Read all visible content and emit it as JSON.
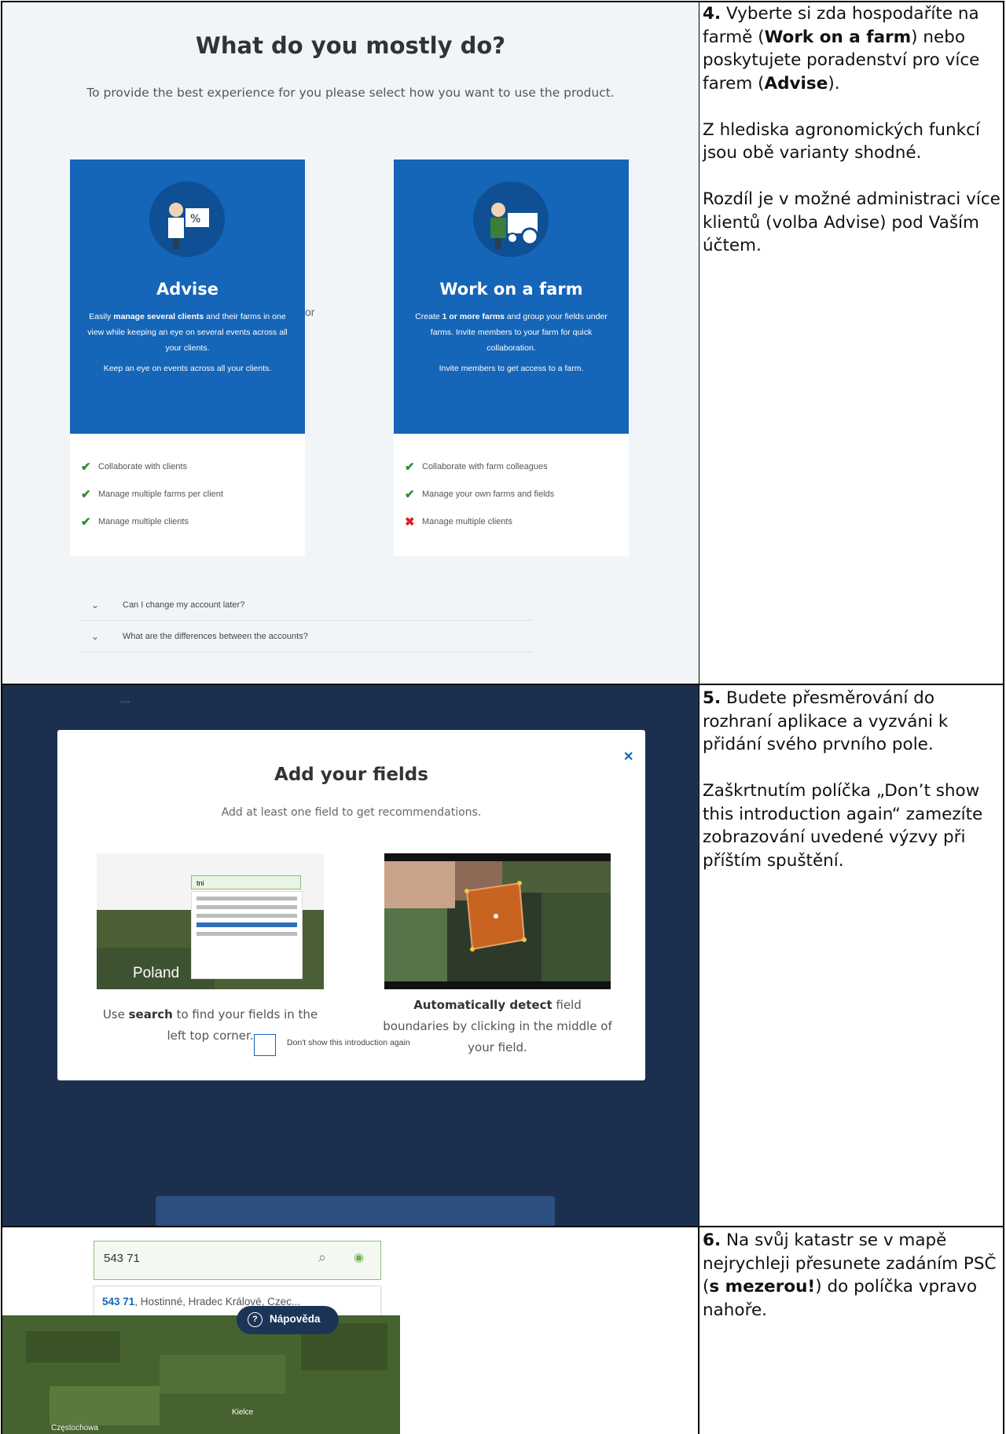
{
  "step4": {
    "heading": "What do you mostly do?",
    "subtitle": "To provide the best experience for you please select how you want to use the product.",
    "advise": {
      "title": "Advise",
      "desc_pre": "Easily ",
      "desc_bold": "manage several clients",
      "desc_post": " and their farms in one view while keeping an eye on several events across all your clients.",
      "desc2": "Keep an eye on events across all your clients.",
      "features": [
        "Collaborate with clients",
        "Manage multiple farms per client",
        "Manage multiple clients"
      ]
    },
    "or_label": "or",
    "farm": {
      "title": "Work on a farm",
      "desc_pre": "Create ",
      "desc_bold": "1 or more farms",
      "desc_post": " and group your fields under farms. Invite members to your farm for quick collaboration.",
      "desc2": "Invite members to get access to a farm.",
      "features": [
        "Collaborate with farm colleagues",
        "Manage your own farms and fields",
        "Manage multiple clients"
      ]
    },
    "faq": [
      "Can I change my account later?",
      "What are the differences between the accounts?"
    ],
    "text": {
      "num": "4.",
      "p1_a": " Vyberte si zda hospodaříte na farmě (",
      "p1_b": "Work on a farm",
      "p1_c": ") nebo poskytujete poradenství pro více farem (",
      "p1_d": "Advise",
      "p1_e": ").",
      "p2": "Z hlediska agronomických funkcí jsou obě varianty shodné.",
      "p3": "Rozdíl je v možné administraci více klientů (volba Advise) pod Vaším účtem."
    }
  },
  "step5": {
    "modal_title": "Add your fields",
    "modal_sub": "Add at least one field to get recommendations.",
    "thumb_search": "tni",
    "thumb_place": "Poland",
    "cap1_pre": "Use ",
    "cap1_bold": "search",
    "cap1_post": " to find your fields in the left top corner.",
    "cap2_bold": "Automatically detect",
    "cap2_post": " field boundaries by clicking in the middle of your field.",
    "checkbox_label": "Don't show this introduction again",
    "text": {
      "num": "5.",
      "p1": " Budete přesměrování do rozhraní aplikace a vyzváni k přidání svého prvního pole.",
      "p2": "Zaškrtnutím políčka „Don’t show this introduction again“ zamezíte zobrazování uvedené výzvy při příštím spuštění."
    }
  },
  "step6": {
    "search_value": "543 71",
    "suggest_bold": "543 71",
    "suggest_rest": ", Hostinné, Hradec Králové, Czec...",
    "help_label": "Nápověda",
    "map_label_1": "Częstochowa",
    "map_label_2": "Kielce",
    "text": {
      "num": "6.",
      "p1_a": " Na svůj katastr se v mapě nejrychleji přesunete zadáním PSČ (",
      "p1_b": "s mezerou!",
      "p1_c": ") do políčka vpravo nahoře."
    }
  }
}
